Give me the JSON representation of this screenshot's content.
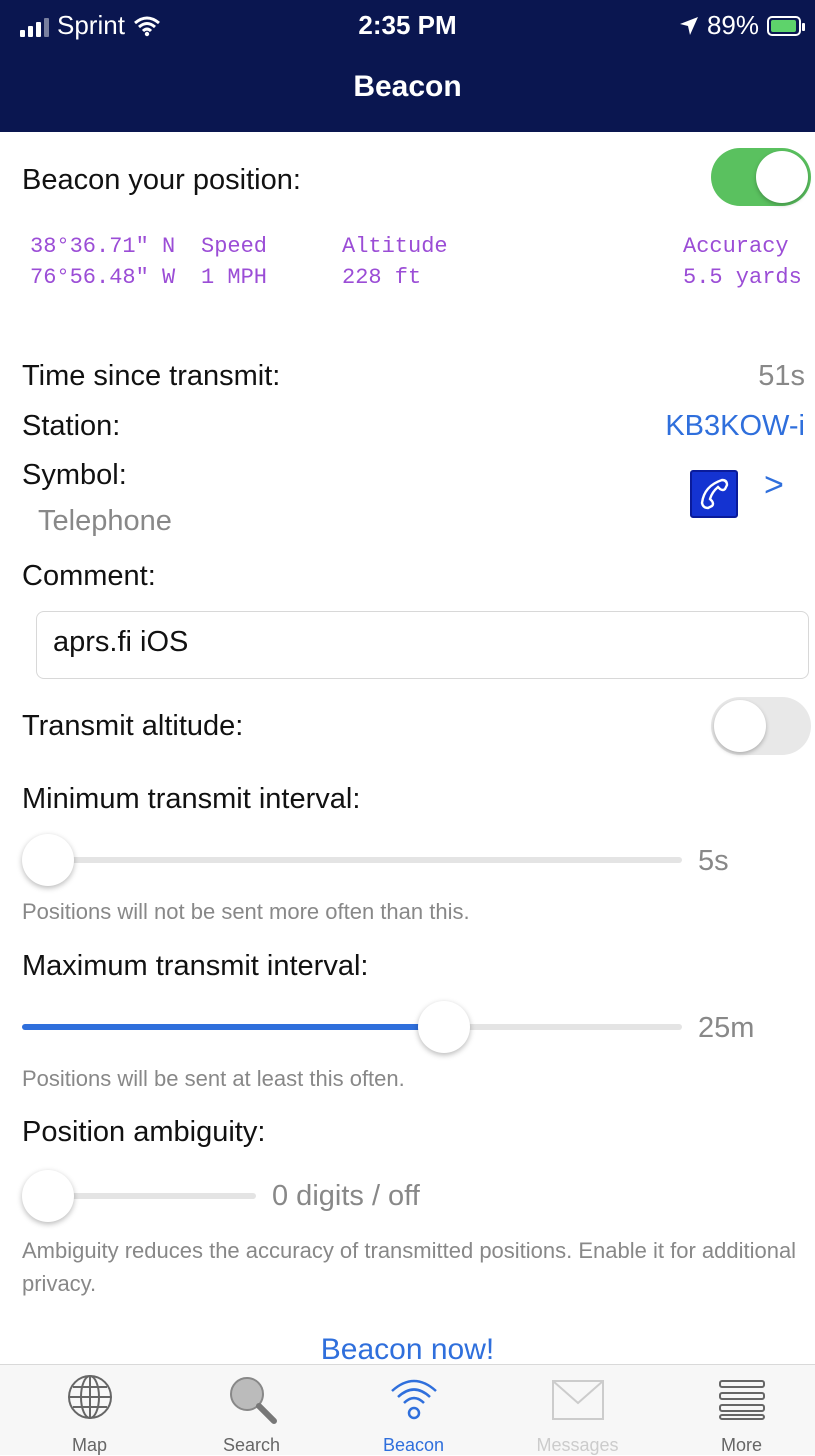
{
  "status_bar": {
    "carrier": "Sprint",
    "time": "2:35 PM",
    "battery": "89%"
  },
  "nav": {
    "title": "Beacon"
  },
  "beacon": {
    "label": "Beacon your position:",
    "enabled": true
  },
  "gps": {
    "lat": "38°36.71\" N",
    "lon": "76°56.48\" W",
    "speed_label": "Speed",
    "speed_value": "1 MPH",
    "altitude_label": "Altitude",
    "altitude_value": "228 ft",
    "accuracy_label": "Accuracy",
    "accuracy_value": "5.5 yards"
  },
  "info": {
    "time_label": "Time since transmit:",
    "time_value": "51s",
    "station_label": "Station:",
    "station_value": "KB3KOW-i",
    "symbol_label": "Symbol:",
    "symbol_value": "Telephone",
    "symbol_chevron": ">"
  },
  "comment": {
    "label": "Comment:",
    "value": "aprs.fi iOS"
  },
  "transmit_altitude": {
    "label": "Transmit altitude:",
    "enabled": false
  },
  "min_interval": {
    "label": "Minimum transmit interval:",
    "value": "5s",
    "position": 0.0,
    "hint": "Positions will not be sent more often than this."
  },
  "max_interval": {
    "label": "Maximum transmit interval:",
    "value": "25m",
    "position": 0.64,
    "hint": "Positions will be sent at least this often."
  },
  "ambiguity": {
    "label": "Position ambiguity:",
    "value": "0 digits / off",
    "position": 0.0,
    "hint": "Ambiguity reduces the accuracy of transmitted positions. Enable it for additional privacy."
  },
  "beacon_now": "Beacon now!",
  "tabs": [
    {
      "label": "Map",
      "icon": "globe-icon",
      "state": "normal"
    },
    {
      "label": "Search",
      "icon": "magnifier-icon",
      "state": "normal"
    },
    {
      "label": "Beacon",
      "icon": "wifi-beacon-icon",
      "state": "active"
    },
    {
      "label": "Messages",
      "icon": "envelope-icon",
      "state": "disabled"
    },
    {
      "label": "More",
      "icon": "list-icon",
      "state": "normal"
    }
  ],
  "colors": {
    "nav_bg": "#0a1650",
    "toggle_on": "#5ac15f",
    "accent": "#2f6fdc",
    "gps_text": "#9b4dd6"
  }
}
